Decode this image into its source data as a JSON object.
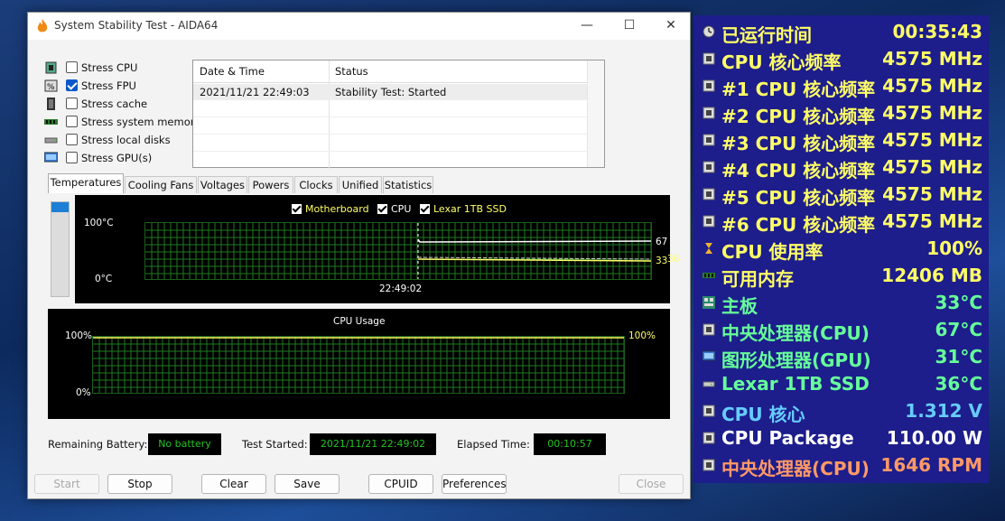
{
  "window": {
    "title": "System Stability Test - AIDA64",
    "controls": {
      "minimize": "—",
      "maximize": "☐",
      "close": "✕"
    }
  },
  "stress_options": [
    {
      "label": "Stress CPU",
      "checked": false,
      "icon": "cpu-icon"
    },
    {
      "label": "Stress FPU",
      "checked": true,
      "icon": "fpu-icon"
    },
    {
      "label": "Stress cache",
      "checked": false,
      "icon": "cache-icon"
    },
    {
      "label": "Stress system memory",
      "checked": false,
      "icon": "memory-icon"
    },
    {
      "label": "Stress local disks",
      "checked": false,
      "icon": "disk-icon"
    },
    {
      "label": "Stress GPU(s)",
      "checked": false,
      "icon": "gpu-icon"
    }
  ],
  "log": {
    "columns": [
      "Date & Time",
      "Status"
    ],
    "rows": [
      {
        "datetime": "2021/11/21 22:49:03",
        "status": "Stability Test: Started"
      }
    ]
  },
  "tabs": [
    "Temperatures",
    "Cooling Fans",
    "Voltages",
    "Powers",
    "Clocks",
    "Unified",
    "Statistics"
  ],
  "active_tab": "Temperatures",
  "temp_graph": {
    "legend": [
      "Motherboard",
      "CPU",
      "Lexar 1TB SSD"
    ],
    "y_max_label": "100°C",
    "y_min_label": "0°C",
    "x_label": "22:49:02",
    "end_labels": {
      "cpu": "67",
      "motherboard": "33",
      "ssd": "36"
    }
  },
  "cpu_graph": {
    "title": "CPU Usage",
    "y_max_label": "100%",
    "y_min_label": "0%",
    "end_label": "100%"
  },
  "status_bar": {
    "battery_label": "Remaining Battery:",
    "battery_value": "No battery",
    "started_label": "Test Started:",
    "started_value": "2021/11/21 22:49:02",
    "elapsed_label": "Elapsed Time:",
    "elapsed_value": "00:10:57"
  },
  "buttons": {
    "start": "Start",
    "stop": "Stop",
    "clear": "Clear",
    "save": "Save",
    "cpuid": "CPUID",
    "preferences": "Preferences",
    "close": "Close"
  },
  "osd": [
    {
      "label": "已运行时间",
      "value": "00:35:43",
      "color": "#ffff66",
      "icon": "clock-icon"
    },
    {
      "label": "CPU 核心频率",
      "value": "4575 MHz",
      "color": "#ffff66",
      "icon": "cpu-icon"
    },
    {
      "label": "#1 CPU 核心频率",
      "value": "4575 MHz",
      "color": "#ffff66",
      "icon": "cpu-icon"
    },
    {
      "label": "#2 CPU 核心频率",
      "value": "4575 MHz",
      "color": "#ffff66",
      "icon": "cpu-icon"
    },
    {
      "label": "#3 CPU 核心频率",
      "value": "4575 MHz",
      "color": "#ffff66",
      "icon": "cpu-icon"
    },
    {
      "label": "#4 CPU 核心频率",
      "value": "4575 MHz",
      "color": "#ffff66",
      "icon": "cpu-icon"
    },
    {
      "label": "#5 CPU 核心频率",
      "value": "4575 MHz",
      "color": "#ffff66",
      "icon": "cpu-icon"
    },
    {
      "label": "#6 CPU 核心频率",
      "value": "4575 MHz",
      "color": "#ffff66",
      "icon": "cpu-icon"
    },
    {
      "label": "CPU 使用率",
      "value": "100%",
      "color": "#ffff66",
      "icon": "hourglass-icon"
    },
    {
      "label": "可用内存",
      "value": "12406 MB",
      "color": "#ffff66",
      "icon": "memory-icon"
    },
    {
      "label": "主板",
      "value": "33°C",
      "color": "#66ff99",
      "icon": "motherboard-icon"
    },
    {
      "label": "中央处理器(CPU)",
      "value": "67°C",
      "color": "#66ff99",
      "icon": "cpu-icon"
    },
    {
      "label": "图形处理器(GPU)",
      "value": "31°C",
      "color": "#66ff99",
      "icon": "gpu-icon"
    },
    {
      "label": "Lexar 1TB SSD",
      "value": "36°C",
      "color": "#66ff99",
      "icon": "disk-icon"
    },
    {
      "label": "CPU 核心",
      "value": "1.312 V",
      "color": "#66ccff",
      "icon": "cpu-icon"
    },
    {
      "label": "CPU Package",
      "value": "110.00 W",
      "color": "#ffffff",
      "icon": "cpu-icon"
    },
    {
      "label": "中央处理器(CPU)",
      "value": "1646 RPM",
      "color": "#ff9966",
      "icon": "cpu-icon"
    }
  ]
}
